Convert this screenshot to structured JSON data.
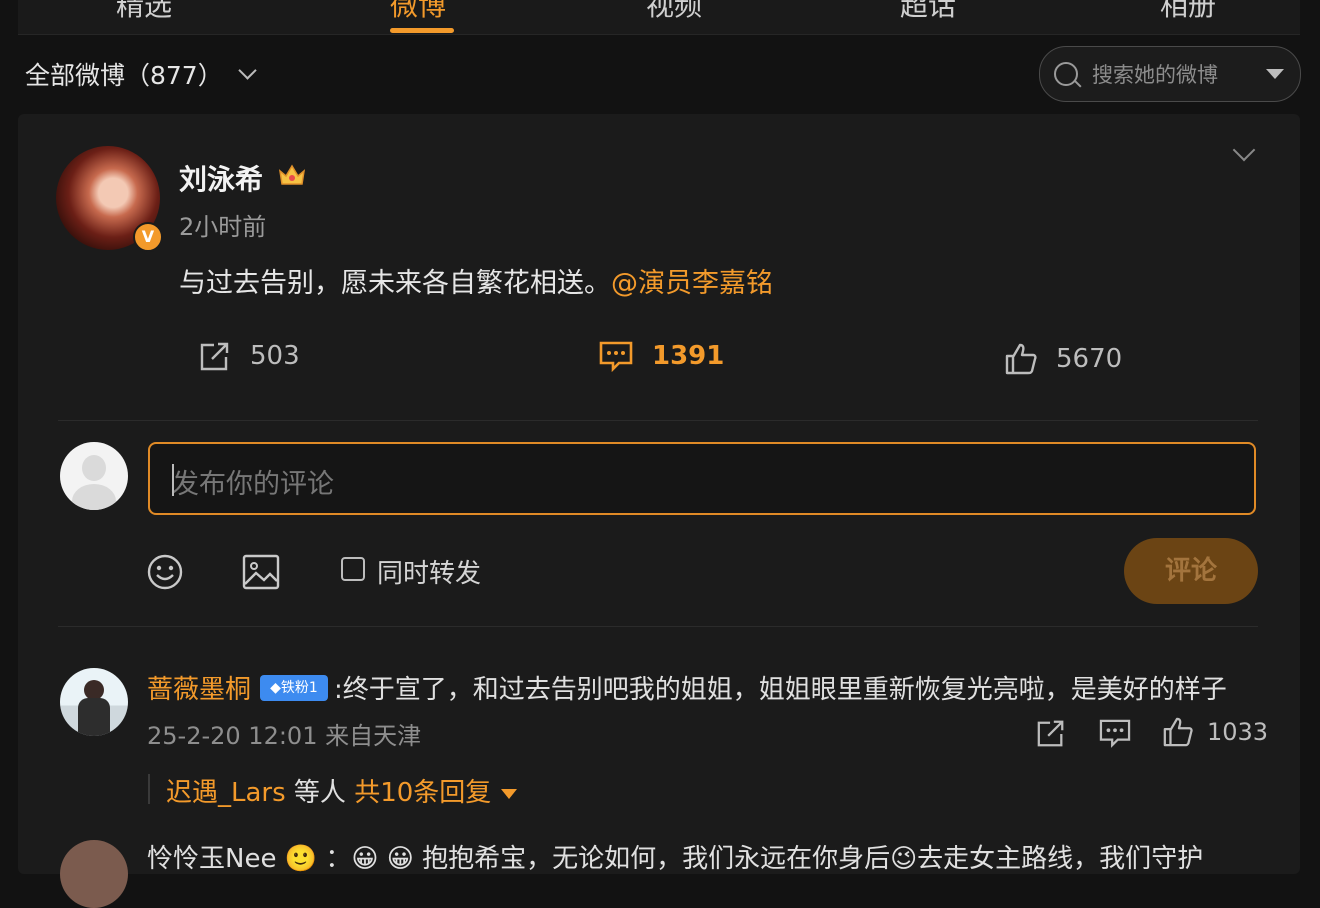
{
  "tabs": [
    "精选",
    "微博",
    "视频",
    "超话",
    "相册"
  ],
  "active_tab": "微博",
  "filter": {
    "label": "全部微博（877）"
  },
  "search": {
    "placeholder": "搜索她的微博"
  },
  "post": {
    "author": "刘泳希",
    "time": "2小时前",
    "text": "与过去告别，愿未来各自繁花相送。",
    "mention": "@演员李嘉铭",
    "reposts": "503",
    "comments": "1391",
    "likes": "5670"
  },
  "composer": {
    "placeholder": "发布你的评论",
    "forward_label": "同时转发",
    "submit_label": "评论"
  },
  "comments": [
    {
      "user": "蔷薇墨桐",
      "badge": "铁粉1",
      "text": ":终于宣了，和过去告别吧我的姐姐，姐姐眼里重新恢复光亮啦，是美好的样子",
      "time": "25-2-20 12:01 来自天津",
      "likes": "1033",
      "reply_user": "迟遇_Lars",
      "reply_mid": " 等人 ",
      "reply_count": "共10条回复"
    },
    {
      "partial_text": "怜怜玉Nee 🙂 ：😀 😀 抱抱希宝，无论如何，我们永远在你身后😉去走女主路线，我们守护"
    }
  ],
  "colors": {
    "accent": "#f39a2b",
    "background": "#121212",
    "card": "#1b1b1b"
  }
}
